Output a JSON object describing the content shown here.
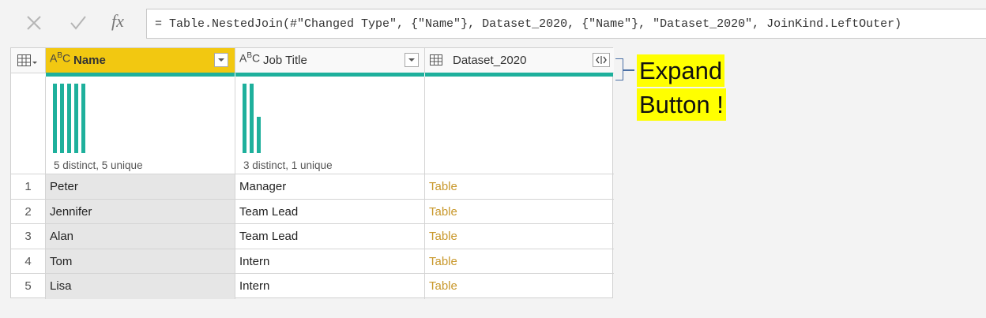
{
  "formula_bar": {
    "cancel_icon": "close-icon",
    "commit_icon": "check-icon",
    "fx_label": "fx",
    "formula": "= Table.NestedJoin(#\"Changed Type\", {\"Name\"}, Dataset_2020, {\"Name\"}, \"Dataset_2020\", JoinKind.LeftOuter)"
  },
  "columns": [
    {
      "name": "Name",
      "type_icon": "text-type-icon",
      "profile": "5 distinct, 5 unique",
      "selected": true
    },
    {
      "name": "Job Title",
      "type_icon": "text-type-icon",
      "profile": "3 distinct, 1 unique",
      "selected": false
    },
    {
      "name": "Dataset_2020",
      "type_icon": "table-type-icon",
      "profile": "",
      "selected": false
    }
  ],
  "rows": [
    {
      "num": "1",
      "name": "Peter",
      "job": "Manager",
      "dataset": "Table"
    },
    {
      "num": "2",
      "name": "Jennifer",
      "job": "Team Lead",
      "dataset": "Table"
    },
    {
      "num": "3",
      "name": "Alan",
      "job": "Team Lead",
      "dataset": "Table"
    },
    {
      "num": "4",
      "name": "Tom",
      "job": "Intern",
      "dataset": "Table"
    },
    {
      "num": "5",
      "name": "Lisa",
      "job": "Intern",
      "dataset": "Table"
    }
  ],
  "annotation": {
    "line1": "Expand",
    "line2": "Button !"
  },
  "colors": {
    "accent": "#1eb09c",
    "selected_header": "#f2c811",
    "table_link": "#c8972a",
    "highlight": "#ffff00"
  }
}
